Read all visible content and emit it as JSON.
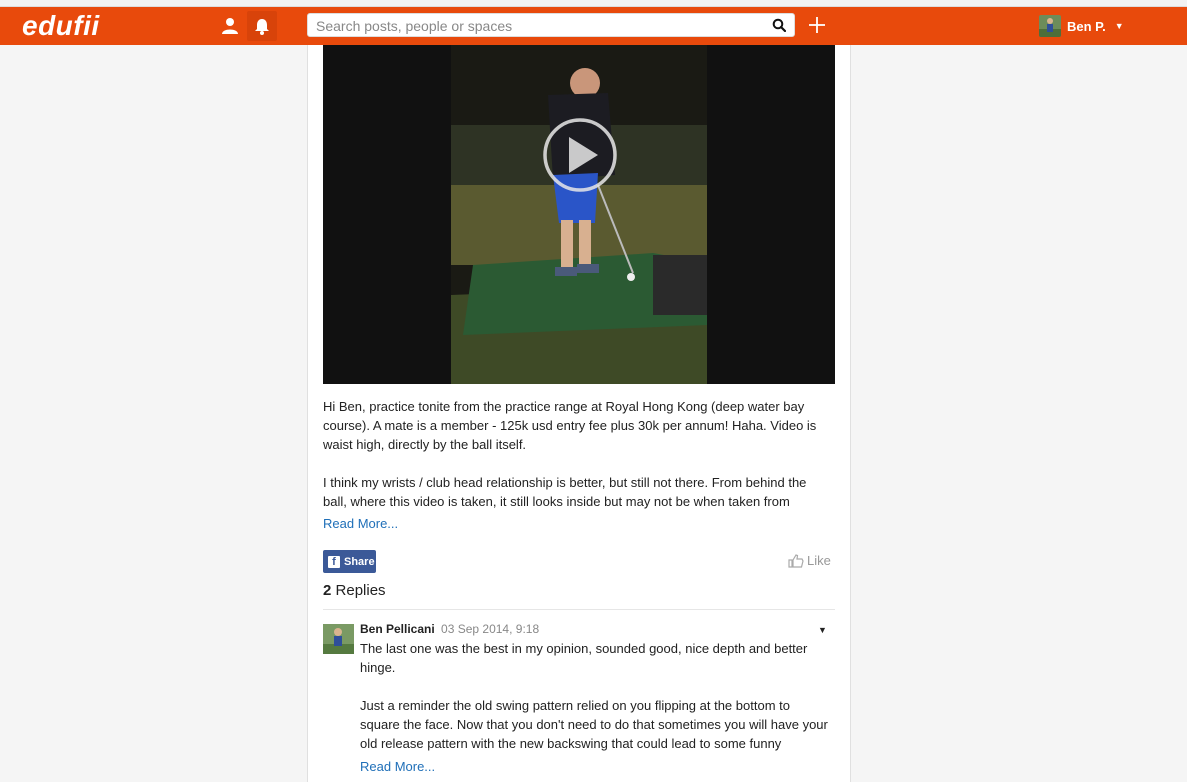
{
  "app": {
    "logo": "edufii"
  },
  "search": {
    "placeholder": "Search posts, people or spaces"
  },
  "profile": {
    "name": "Ben P."
  },
  "post": {
    "paragraph1": "Hi Ben, practice tonite from the practice range at Royal Hong Kong (deep water bay course). A mate is a member - 125k usd entry fee plus 30k per annum! Haha. Video is waist high, directly by the ball itself.",
    "paragraph2": "I think my wrists / club head relationship is better, but still not there. From behind the ball, where this video is taken, it still looks inside but may not be when taken from",
    "read_more": "Read More...",
    "share_label": "Share",
    "like_label": "Like"
  },
  "replies": {
    "count": "2",
    "label": "Replies",
    "items": [
      {
        "author": "Ben Pellicani",
        "time": "03 Sep 2014, 9:18",
        "paragraph1": "The last one was the best in my opinion, sounded good, nice depth and better hinge.",
        "paragraph2": "Just a reminder the old swing pattern relied on you flipping at the bottom to square the face. Now that you don't need to do that sometimes you will have your old release pattern with the new backswing that could lead to some funny",
        "read_more": "Read More..."
      }
    ]
  },
  "colors": {
    "brand": "#e84a0c",
    "link": "#1f6fb8",
    "facebook": "#3b5998"
  },
  "icons": [
    "user-icon",
    "bell-icon",
    "search-icon",
    "plus-icon",
    "play-icon",
    "thumbs-up-icon",
    "facebook-icon",
    "chevron-down-icon"
  ]
}
